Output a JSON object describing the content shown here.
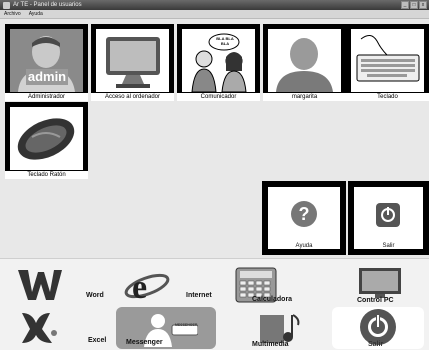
{
  "window": {
    "title": "Ar TE - Panel de usuarios",
    "controls": [
      "_",
      "□",
      "x"
    ]
  },
  "menu": [
    "Archivo",
    "Ayuda"
  ],
  "tiles": [
    {
      "label": "Administrador",
      "icon": "admin-avatar-icon",
      "badge": "admin"
    },
    {
      "label": "Acceso al ordenador",
      "icon": "monitor-icon"
    },
    {
      "label": "Comunicador",
      "icon": "people-talking-icon",
      "bubble": "BLA BLA BLA"
    },
    {
      "label": "margarita",
      "icon": "user-avatar-icon"
    },
    {
      "label": "Teclado",
      "icon": "keyboard-icon"
    },
    {
      "label": "Teclado Ratón",
      "icon": "mouse-icon"
    }
  ],
  "actions": [
    {
      "label": "Ayuda",
      "icon": "help-icon"
    },
    {
      "label": "Salir",
      "icon": "power-icon"
    }
  ],
  "apps": [
    {
      "label": "Word",
      "icon": "word-icon"
    },
    {
      "label": "Internet",
      "icon": "internet-explorer-icon"
    },
    {
      "label": "Calculadora",
      "icon": "calculator-icon"
    },
    {
      "label": "Control PC",
      "icon": "control-pc-icon"
    },
    {
      "label": "Excel",
      "icon": "excel-icon"
    },
    {
      "label": "Messenger",
      "icon": "messenger-icon"
    },
    {
      "label": "Multimedia",
      "icon": "multimedia-icon"
    },
    {
      "label": "Salir",
      "icon": "power-icon"
    }
  ],
  "messenger_badge": "MESSENGER"
}
